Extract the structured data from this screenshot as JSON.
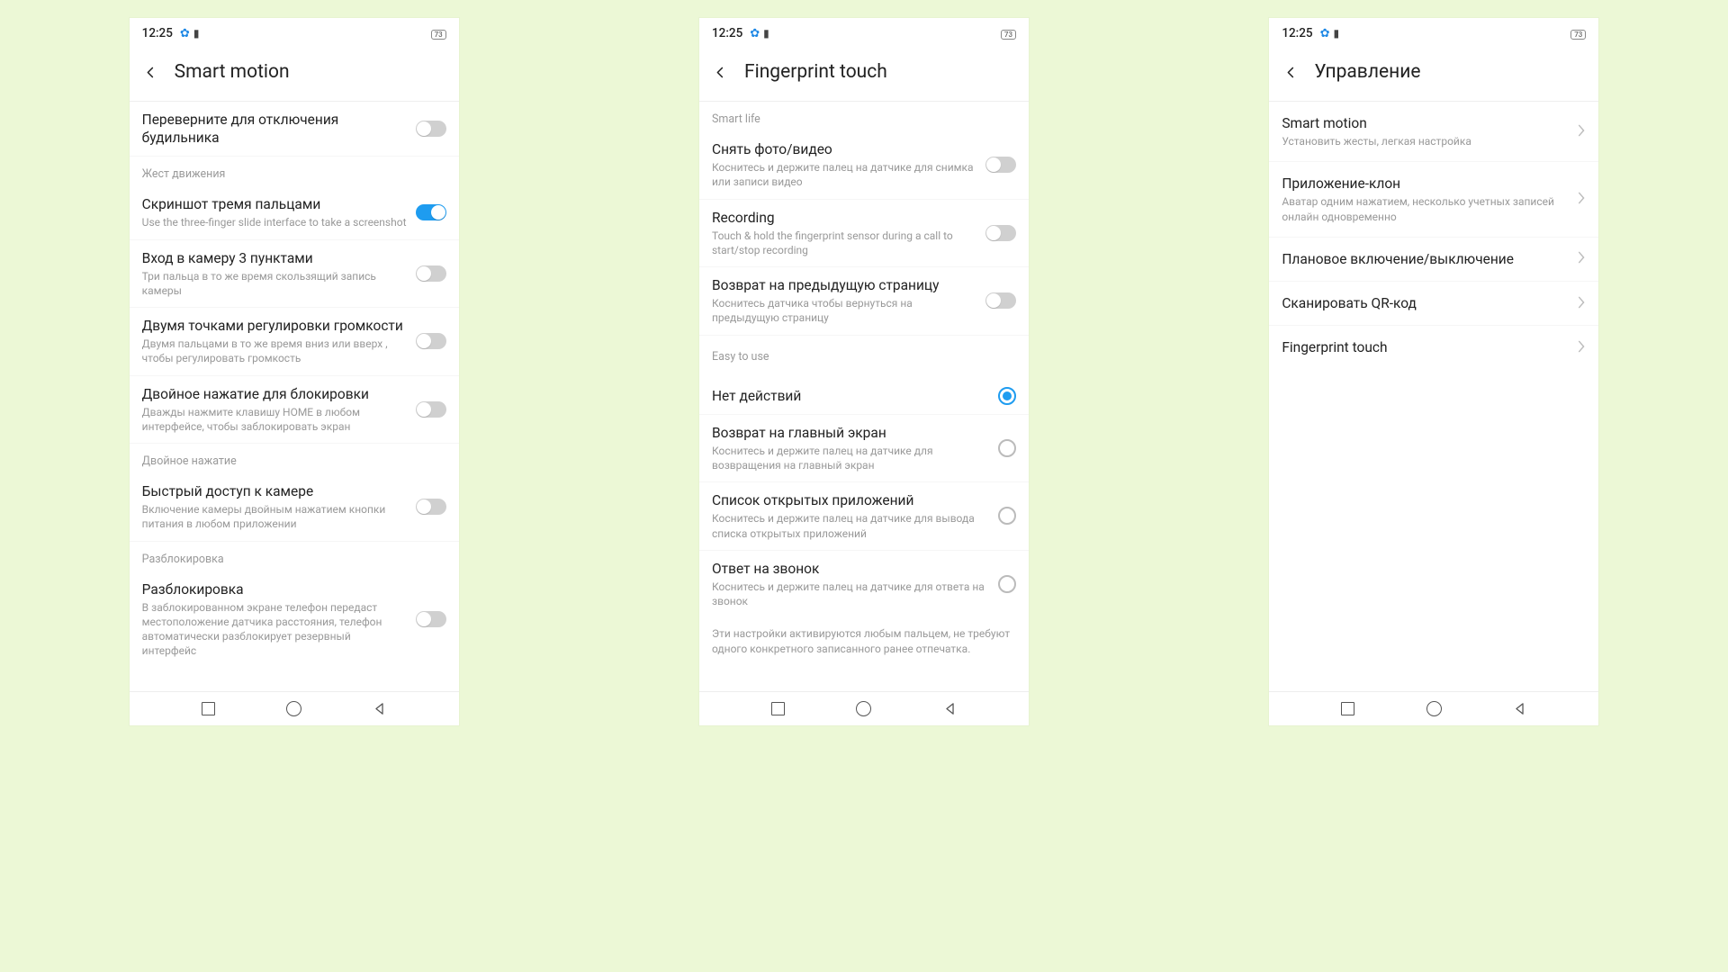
{
  "status": {
    "time": "12:25",
    "battery": "73"
  },
  "phone1": {
    "title": "Smart motion",
    "items": [
      {
        "title": "Переверните для отключения будильника",
        "sub": "",
        "toggle": false
      },
      {
        "section": "Жест движения"
      },
      {
        "title": "Скриншот тремя пальцами",
        "sub": "Use the three-finger slide interface to take a screenshot",
        "toggle": true
      },
      {
        "title": "Вход в камеру 3 пунктами",
        "sub": "Три пальца в то же время скользящий запись камеры",
        "toggle": false
      },
      {
        "title": "Двумя точками регулировки громкости",
        "sub": "Двумя пальцами в то же время вниз или вверх , чтобы регулировать громкость",
        "toggle": false
      },
      {
        "title": "Двойное нажатие для блокировки",
        "sub": "Дважды нажмите клавишу HOME в любом интерфейсе, чтобы заблокировать экран",
        "toggle": false
      },
      {
        "section": "Двойное нажатие"
      },
      {
        "title": "Быстрый доступ к камере",
        "sub": "Включение камеры двойным нажатием кнопки питания в любом приложении",
        "toggle": false
      },
      {
        "section": "Разблокировка"
      },
      {
        "title": "Разблокировка",
        "sub": "В заблокированном экране телефон передаст местоположение датчика расстояния, телефон автоматически разблокирует резервный интерфейс",
        "toggle": false
      }
    ]
  },
  "phone2": {
    "title": "Fingerprint touch",
    "sections": {
      "s1": "Smart life",
      "s2": "Easy to use"
    },
    "items1": [
      {
        "title": "Снять фото/видео",
        "sub": "Коснитесь и держите палец на датчике для снимка или записи видео",
        "toggle": false
      },
      {
        "title": "Recording",
        "sub": "Touch & hold the fingerprint sensor during a call to start/stop recording",
        "toggle": false
      },
      {
        "title": "Возврат на предыдущую страницу",
        "sub": "Коснитесь датчика чтобы вернуться на предыдущую страницу",
        "toggle": false
      }
    ],
    "items2": [
      {
        "title": "Нет действий",
        "sub": "",
        "radio": true
      },
      {
        "title": "Возврат на главный экран",
        "sub": "Коснитесь и держите палец на датчике для возвращения на главный экран",
        "radio": false
      },
      {
        "title": "Список открытых приложений",
        "sub": "Коснитесь и держите палец на датчике для вывода списка открытых приложений",
        "radio": false
      },
      {
        "title": "Ответ на звонок",
        "sub": "Коснитесь и держите палец на датчике для ответа на звонок",
        "radio": false
      }
    ],
    "footer": "Эти настройки активируются любым пальцем, не требуют одного конкретного записанного ранее отпечатка."
  },
  "phone3": {
    "title": "Управление",
    "items": [
      {
        "title": "Smart motion",
        "sub": "Установить жесты, легкая настройка"
      },
      {
        "title": "Приложение-клон",
        "sub": "Аватар одним нажатием, несколько учетных записей онлайн одновременно"
      },
      {
        "title": "Плановое включение/выключение",
        "sub": ""
      },
      {
        "title": "Сканировать QR-код",
        "sub": ""
      },
      {
        "title": "Fingerprint touch",
        "sub": ""
      }
    ]
  }
}
